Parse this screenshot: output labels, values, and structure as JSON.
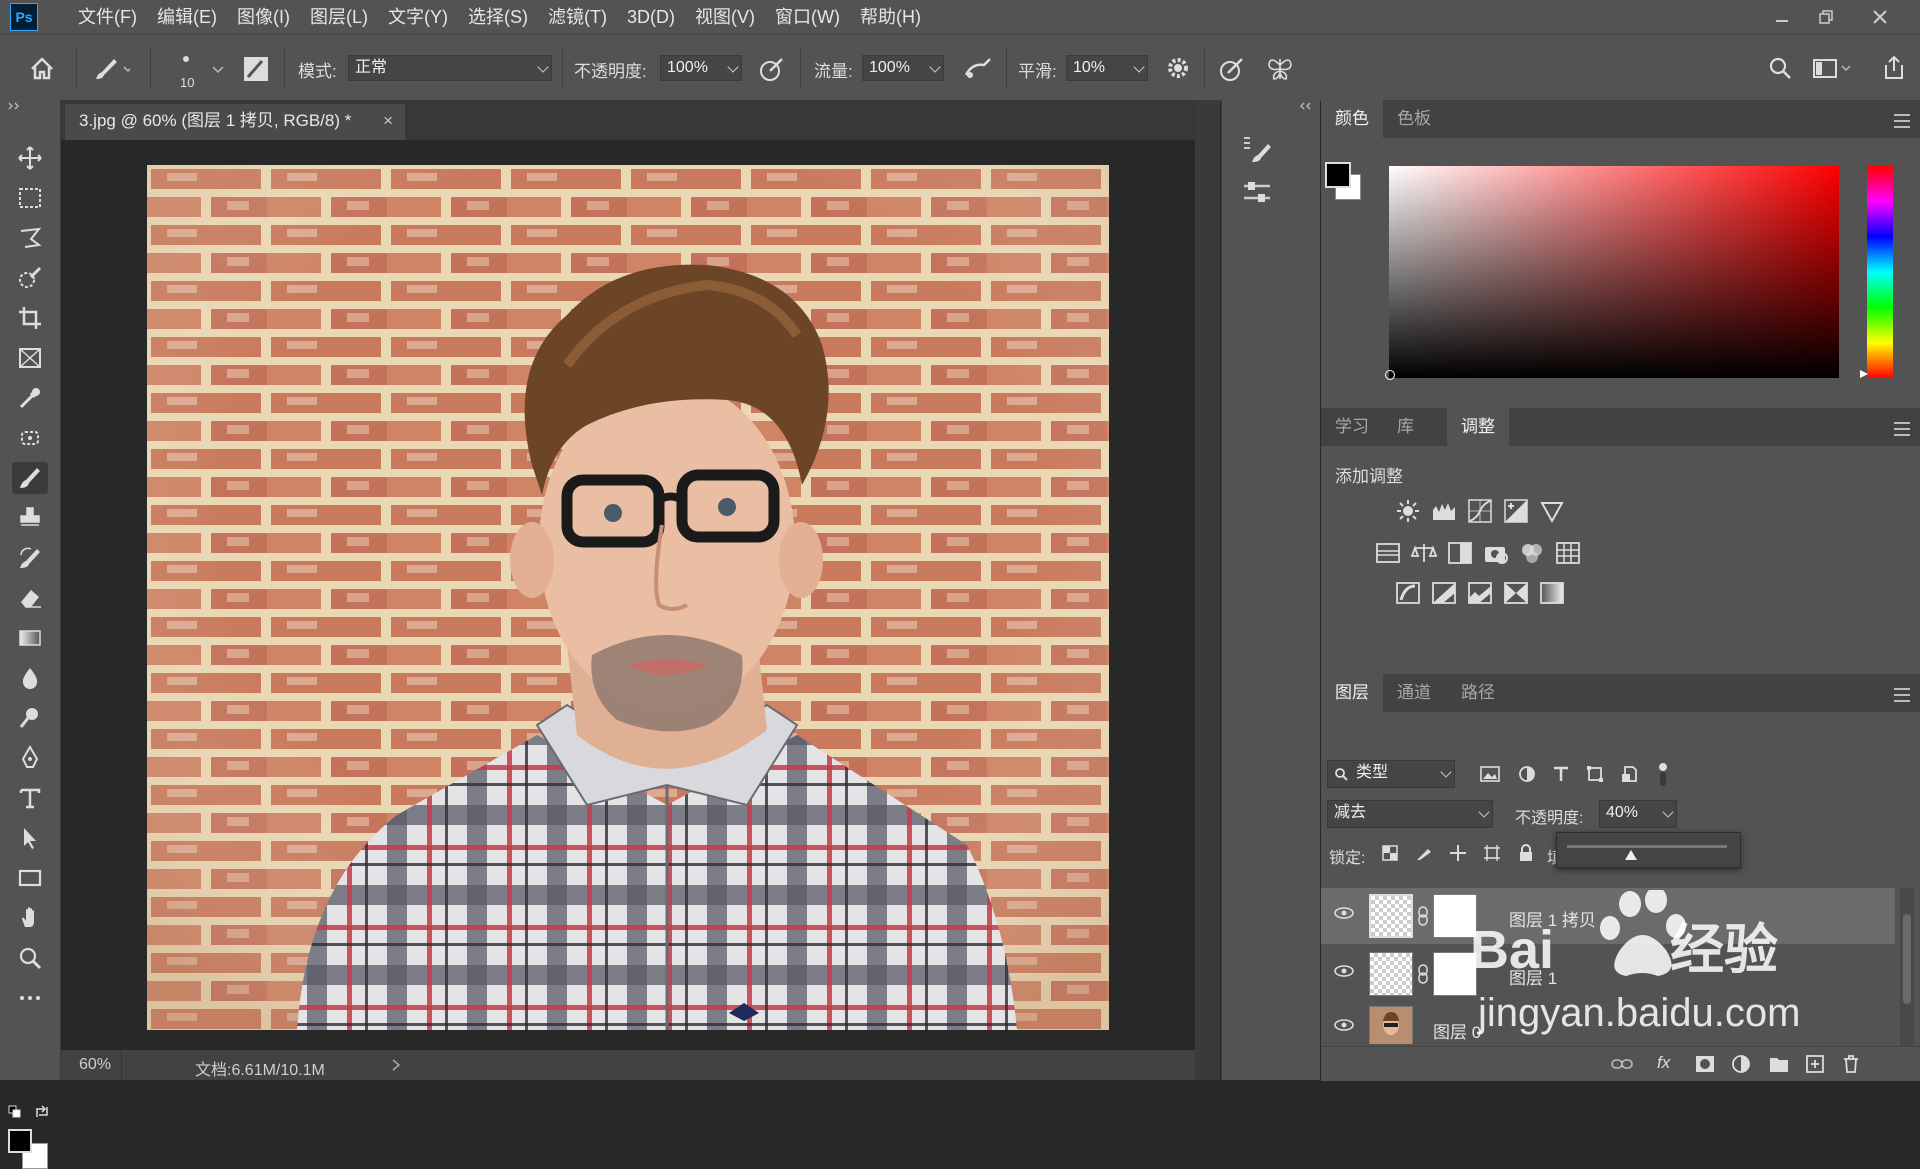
{
  "app": {
    "logo": "Ps"
  },
  "menu": [
    "文件(F)",
    "编辑(E)",
    "图像(I)",
    "图层(L)",
    "文字(Y)",
    "选择(S)",
    "滤镜(T)",
    "3D(D)",
    "视图(V)",
    "窗口(W)",
    "帮助(H)"
  ],
  "options": {
    "brush_size": "10",
    "mode_label": "模式:",
    "mode_value": "正常",
    "opacity_label": "不透明度:",
    "opacity_value": "100%",
    "flow_label": "流量:",
    "flow_value": "100%",
    "smooth_label": "平滑:",
    "smooth_value": "10%"
  },
  "document": {
    "tab_title": "3.jpg @ 60% (图层 1 拷贝, RGB/8) *",
    "zoom": "60%",
    "doc_info": "文档:6.61M/10.1M"
  },
  "color_panel": {
    "tabs": [
      "颜色",
      "色板"
    ],
    "active_tab": "颜色",
    "foreground": "#000000",
    "background": "#ffffff",
    "hue_color": "#ff0000"
  },
  "adjust_panel": {
    "tabs": [
      "学习",
      "库",
      "调整"
    ],
    "active_tab": "调整",
    "title": "添加调整",
    "icons": [
      [
        "brightness-contrast-icon",
        "levels-icon",
        "curves-icon",
        "exposure-icon",
        "vibrance-icon"
      ],
      [
        "hue-saturation-icon",
        "color-balance-icon",
        "black-white-icon",
        "photo-filter-icon",
        "channel-mixer-icon",
        "color-lookup-icon"
      ],
      [
        "invert-icon",
        "posterize-icon",
        "threshold-icon",
        "selective-color-icon",
        "gradient-map-icon"
      ]
    ]
  },
  "layers_panel": {
    "tabs": [
      "图层",
      "通道",
      "路径"
    ],
    "active_tab": "图层",
    "filter_label": "类型",
    "blend_mode": "减去",
    "opacity_label": "不透明度:",
    "opacity_value": "40%",
    "opacity_slider": 0.4,
    "lock_label": "锁定:",
    "fill_label_partial": "填",
    "layers": [
      {
        "name": "图层 1 拷贝",
        "selected": true
      },
      {
        "name": "图层 1",
        "selected": false
      },
      {
        "name": "图层 0",
        "selected": false
      }
    ],
    "footer_icons": [
      "link-icon",
      "fx-icon",
      "mask-icon",
      "adjustment-icon",
      "group-icon",
      "new-layer-icon",
      "trash-icon"
    ]
  },
  "watermark": {
    "brand": "Baidu经验",
    "url": "jingyan.baidu.com"
  }
}
